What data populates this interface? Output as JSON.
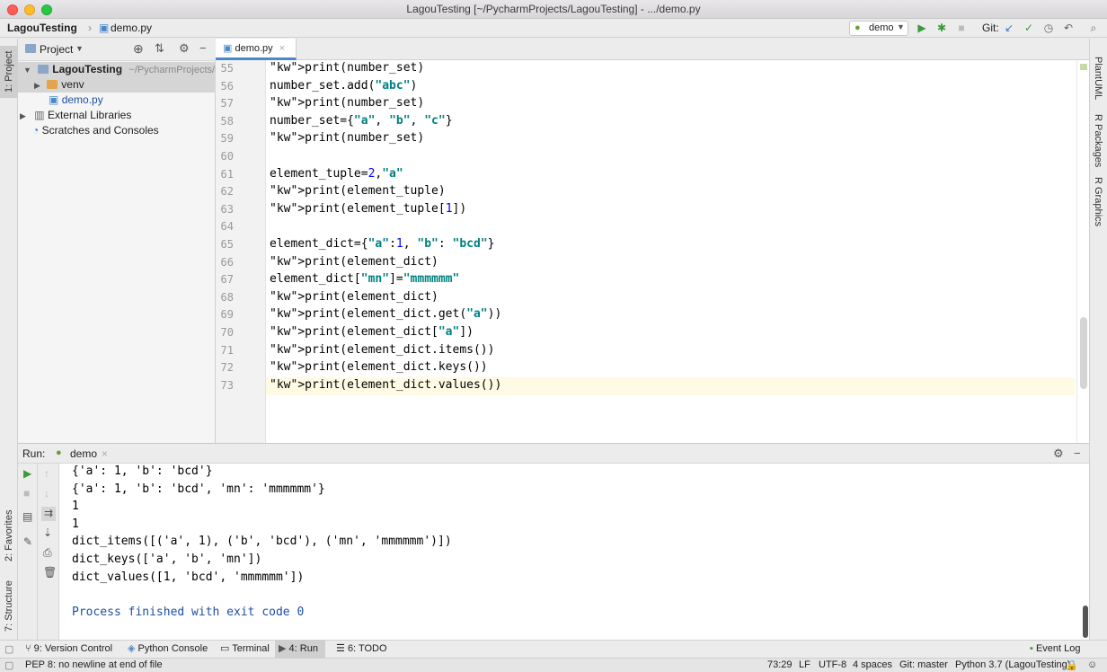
{
  "window": {
    "title": "LagouTesting [~/PycharmProjects/LagouTesting] - .../demo.py"
  },
  "nav": {
    "breadcrumb_project": "LagouTesting",
    "breadcrumb_file": "demo.py",
    "run_config": "demo",
    "git_label": "Git:"
  },
  "left_tools": {
    "project": "1: Project",
    "favorites": "2: Favorites",
    "structure": "7: Structure"
  },
  "right_tools": {
    "plantuml": "PlantUML",
    "rpackages": "R Packages",
    "rgraphics": "R Graphics"
  },
  "project": {
    "title": "Project",
    "root_name": "LagouTesting",
    "root_path": "~/PycharmProjects/L",
    "items": [
      {
        "label": "venv"
      },
      {
        "label": "demo.py"
      },
      {
        "label": "External Libraries"
      },
      {
        "label": "Scratches and Consoles"
      }
    ]
  },
  "editor": {
    "tab": "demo.py",
    "lines": [
      {
        "n": "55",
        "html": "print(number_set)"
      },
      {
        "n": "56",
        "html": "number_set.add(\"abc\")"
      },
      {
        "n": "57",
        "html": "print(number_set)"
      },
      {
        "n": "58",
        "html": "number_set={\"a\", \"b\", \"c\"}"
      },
      {
        "n": "59",
        "html": "print(number_set)"
      },
      {
        "n": "60",
        "html": ""
      },
      {
        "n": "61",
        "html": "element_tuple=2,\"a\""
      },
      {
        "n": "62",
        "html": "print(element_tuple)"
      },
      {
        "n": "63",
        "html": "print(element_tuple[1])"
      },
      {
        "n": "64",
        "html": ""
      },
      {
        "n": "65",
        "html": "element_dict={\"a\":1, \"b\": \"bcd\"}"
      },
      {
        "n": "66",
        "html": "print(element_dict)"
      },
      {
        "n": "67",
        "html": "element_dict[\"mn\"]=\"mmmmmm\""
      },
      {
        "n": "68",
        "html": "print(element_dict)"
      },
      {
        "n": "69",
        "html": "print(element_dict.get(\"a\"))"
      },
      {
        "n": "70",
        "html": "print(element_dict[\"a\"])"
      },
      {
        "n": "71",
        "html": "print(element_dict.items())"
      },
      {
        "n": "72",
        "html": "print(element_dict.keys())"
      },
      {
        "n": "73",
        "html": "print(element_dict.values())"
      }
    ]
  },
  "run": {
    "label": "Run:",
    "config": "demo",
    "output": [
      "{'a': 1, 'b': 'bcd'}",
      "{'a': 1, 'b': 'bcd', 'mn': 'mmmmmm'}",
      "1",
      "1",
      "dict_items([('a', 1), ('b', 'bcd'), ('mn', 'mmmmmm')])",
      "dict_keys(['a', 'b', 'mn'])",
      "dict_values([1, 'bcd', 'mmmmmm'])",
      "",
      "Process finished with exit code 0"
    ]
  },
  "toolwindows": {
    "version_control": "9: Version Control",
    "python_console": "Python Console",
    "terminal": "Terminal",
    "run": "4: Run",
    "todo": "6: TODO",
    "event_log": "Event Log"
  },
  "status": {
    "message": "PEP 8: no newline at end of file",
    "position": "73:29",
    "line_sep": "LF",
    "encoding": "UTF-8",
    "indent": "4 spaces",
    "git": "Git: master",
    "interpreter": "Python 3.7 (LagouTesting)"
  },
  "colors": {
    "keyword": "#000080",
    "string": "#008080",
    "number": "#0000ff",
    "accent": "#4a88c7"
  }
}
